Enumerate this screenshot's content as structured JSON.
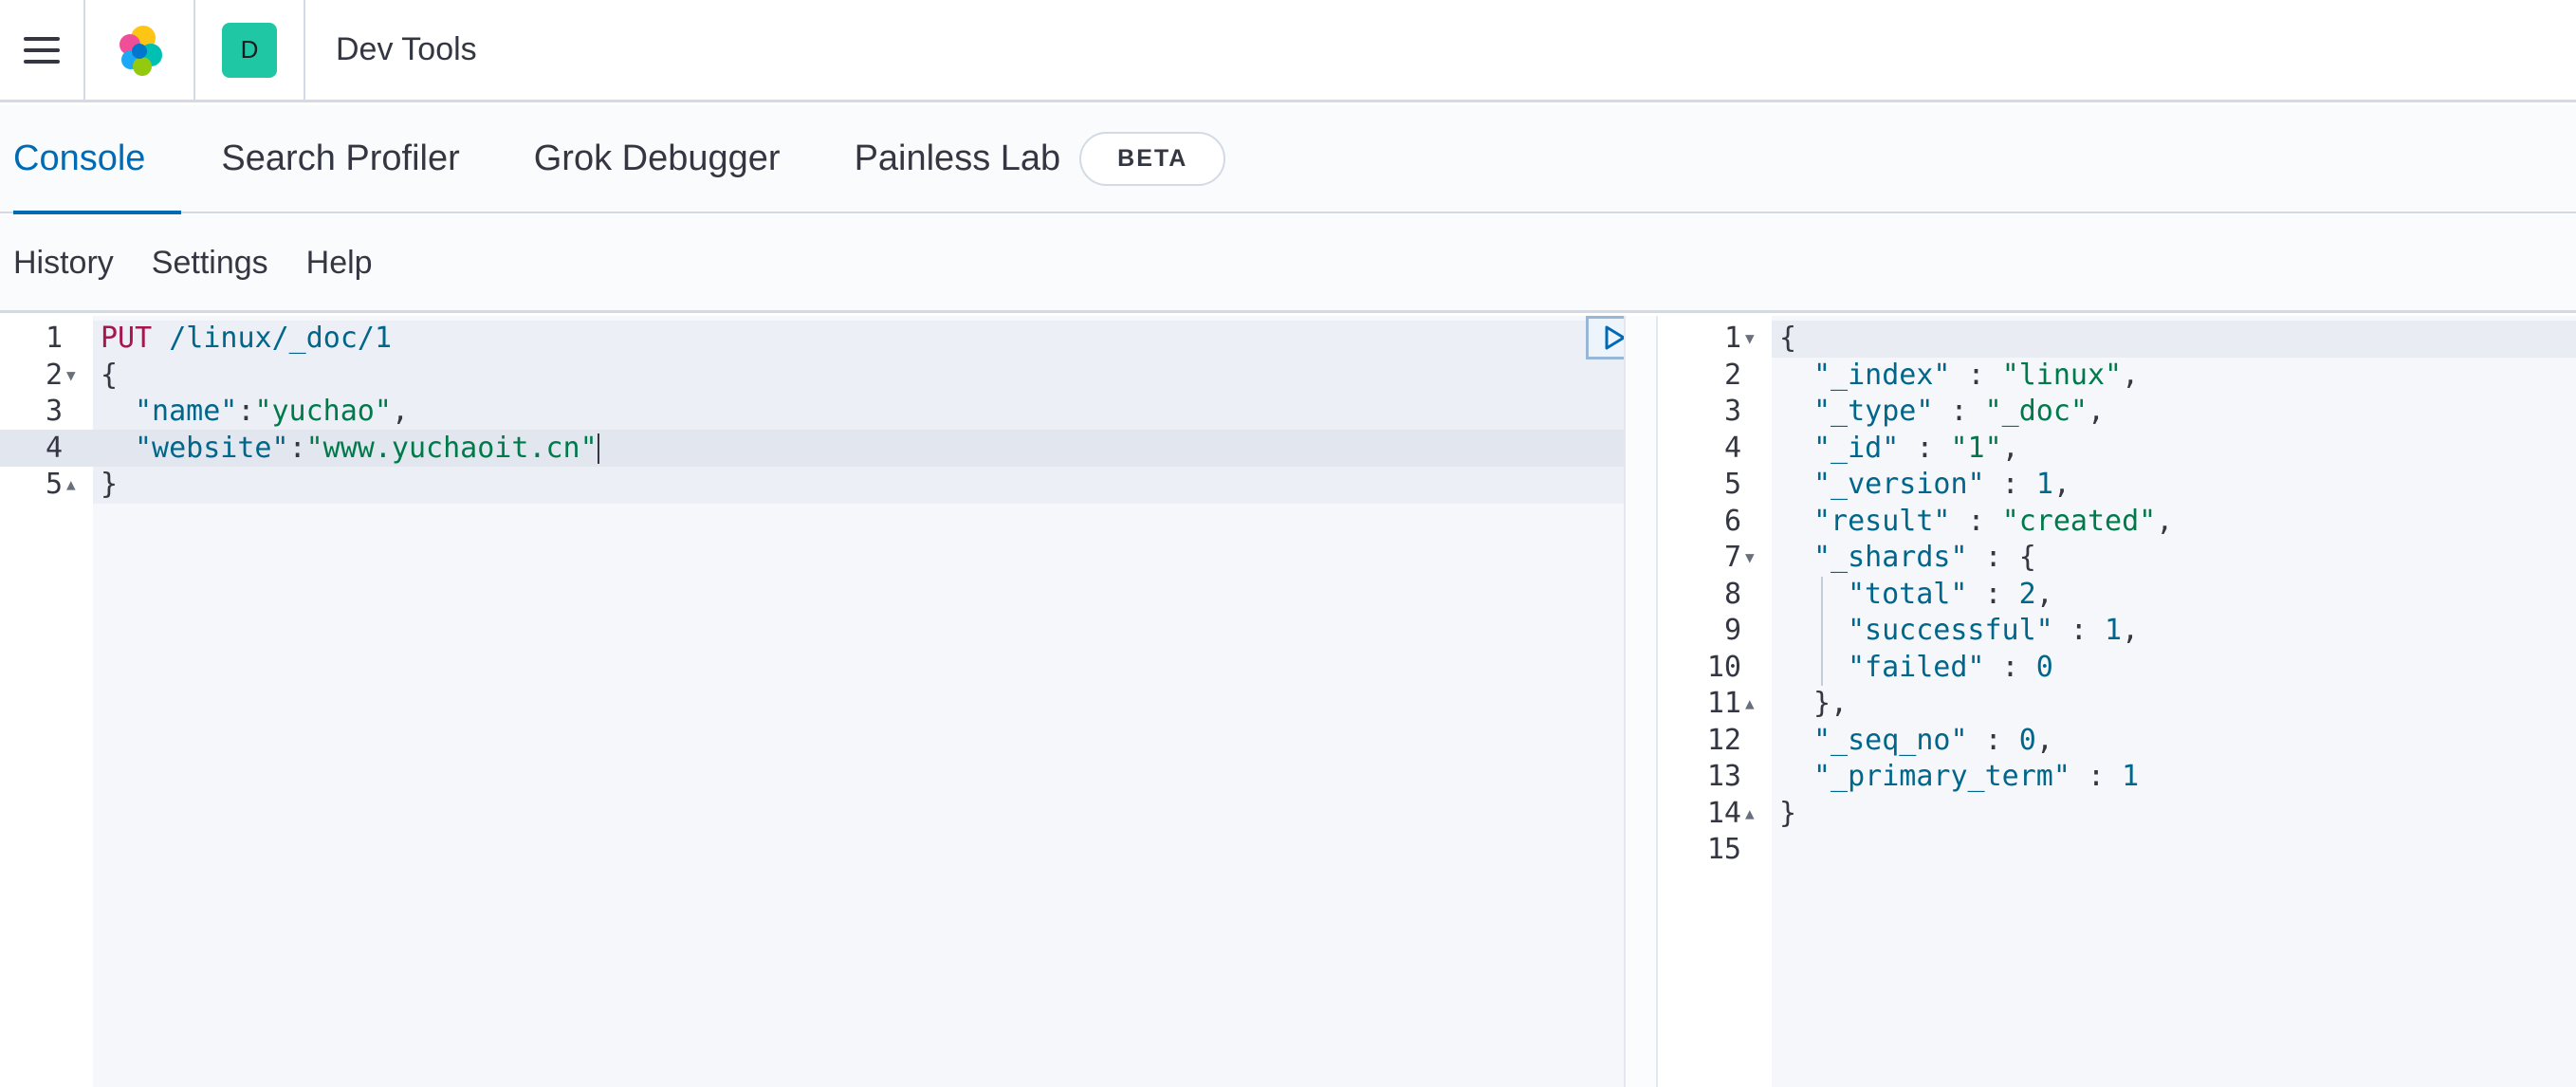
{
  "header": {
    "space_initial": "D",
    "app_title": "Dev Tools"
  },
  "tabs": [
    {
      "label": "Console",
      "active": true
    },
    {
      "label": "Search Profiler"
    },
    {
      "label": "Grok Debugger"
    },
    {
      "label": "Painless Lab",
      "badge": "BETA"
    }
  ],
  "menu": {
    "history": "History",
    "settings": "Settings",
    "help": "Help"
  },
  "request_editor": {
    "line_numbers": [
      "1",
      "2",
      "3",
      "4",
      "5"
    ],
    "method": "PUT",
    "url": " /linux/_doc/1",
    "open_brace": "{",
    "name_key": "\"name\"",
    "name_sep": ":",
    "name_val": "\"yuchao\"",
    "name_comma": ",",
    "website_key": "\"website\"",
    "website_sep": ":",
    "website_val": "\"www.yuchaoit.cn\"",
    "close_brace": "}"
  },
  "response_editor": {
    "line_numbers": [
      "1",
      "2",
      "3",
      "4",
      "5",
      "6",
      "7",
      "8",
      "9",
      "10",
      "11",
      "12",
      "13",
      "14",
      "15"
    ],
    "lines": [
      {
        "indent": 0,
        "key": "",
        "sep": "",
        "val": "",
        "punc": "{"
      },
      {
        "indent": 1,
        "key": "\"_index\"",
        "sep": " : ",
        "val": "\"linux\"",
        "vtype": "str",
        "punc": ","
      },
      {
        "indent": 1,
        "key": "\"_type\"",
        "sep": " : ",
        "val": "\"_doc\"",
        "vtype": "str",
        "punc": ","
      },
      {
        "indent": 1,
        "key": "\"_id\"",
        "sep": " : ",
        "val": "\"1\"",
        "vtype": "str",
        "punc": ","
      },
      {
        "indent": 1,
        "key": "\"_version\"",
        "sep": " : ",
        "val": "1",
        "vtype": "num",
        "punc": ","
      },
      {
        "indent": 1,
        "key": "\"result\"",
        "sep": " : ",
        "val": "\"created\"",
        "vtype": "str",
        "punc": ","
      },
      {
        "indent": 1,
        "key": "\"_shards\"",
        "sep": " : ",
        "val": "",
        "vtype": "str",
        "punc": "{"
      },
      {
        "indent": 2,
        "key": "\"total\"",
        "sep": " : ",
        "val": "2",
        "vtype": "num",
        "punc": ","
      },
      {
        "indent": 2,
        "key": "\"successful\"",
        "sep": " : ",
        "val": "1",
        "vtype": "num",
        "punc": ","
      },
      {
        "indent": 2,
        "key": "\"failed\"",
        "sep": " : ",
        "val": "0",
        "vtype": "num",
        "punc": ""
      },
      {
        "indent": 1,
        "key": "",
        "sep": "",
        "val": "",
        "punc": "},"
      },
      {
        "indent": 1,
        "key": "\"_seq_no\"",
        "sep": " : ",
        "val": "0",
        "vtype": "num",
        "punc": ","
      },
      {
        "indent": 1,
        "key": "\"_primary_term\"",
        "sep": " : ",
        "val": "1",
        "vtype": "num",
        "punc": ""
      },
      {
        "indent": 0,
        "key": "",
        "sep": "",
        "val": "",
        "punc": "}"
      },
      {
        "indent": 0,
        "key": "",
        "sep": "",
        "val": "",
        "punc": ""
      }
    ]
  },
  "icons": {
    "menu": "hamburger-icon",
    "logo": "elastic-logo-icon",
    "run": "play-icon",
    "settings": "wrench-icon",
    "fold_open": "fold-caret-down-icon",
    "fold_close": "fold-caret-up-icon"
  },
  "colors": {
    "accent": "#006bb4",
    "space_avatar": "#20c7a4",
    "method": "#a6164f",
    "string": "#007a4a",
    "key": "#00668b"
  }
}
